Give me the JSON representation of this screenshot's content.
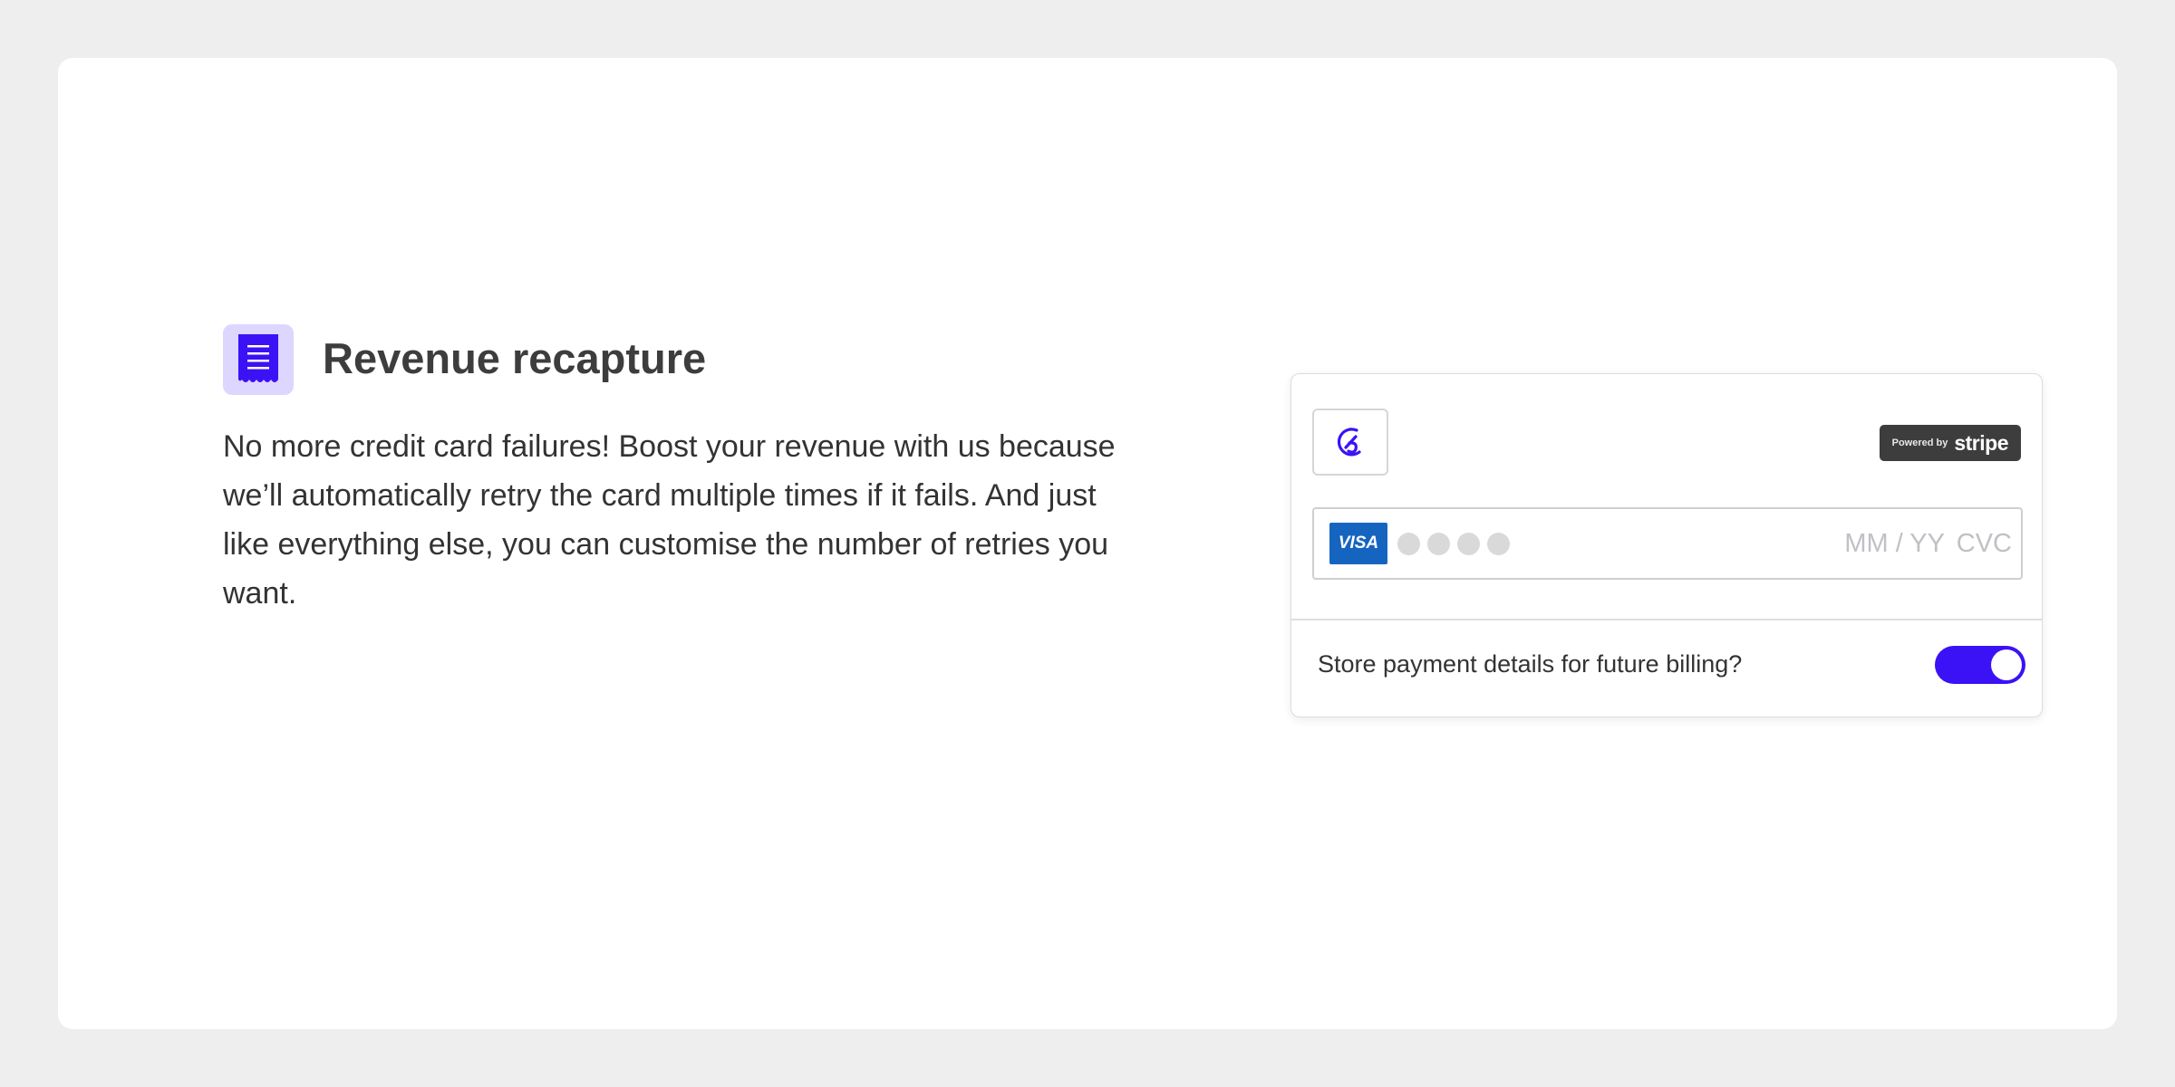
{
  "feature": {
    "icon": "receipt-icon",
    "title": "Revenue recapture",
    "description": "No more credit card failures! Boost your revenue with us because we’ll automatically retry the card multiple times if it fails. And just like everything else, you can customise the number of retries you want."
  },
  "payment_widget": {
    "merchant_logo": "merchant-logo-icon",
    "badge": {
      "prefix": "Powered by",
      "brand": "stripe"
    },
    "card_input": {
      "brand": "VISA",
      "number_masked": "●●●●",
      "expiry_placeholder": "MM / YY",
      "cvc_placeholder": "CVC"
    },
    "store_details": {
      "label": "Store payment details for future billing?",
      "enabled": true
    }
  },
  "colors": {
    "accent": "#3b12f5",
    "icon_background": "#ddd6fe",
    "visa_blue": "#1565c0",
    "badge_dark": "#3d3d3d"
  }
}
